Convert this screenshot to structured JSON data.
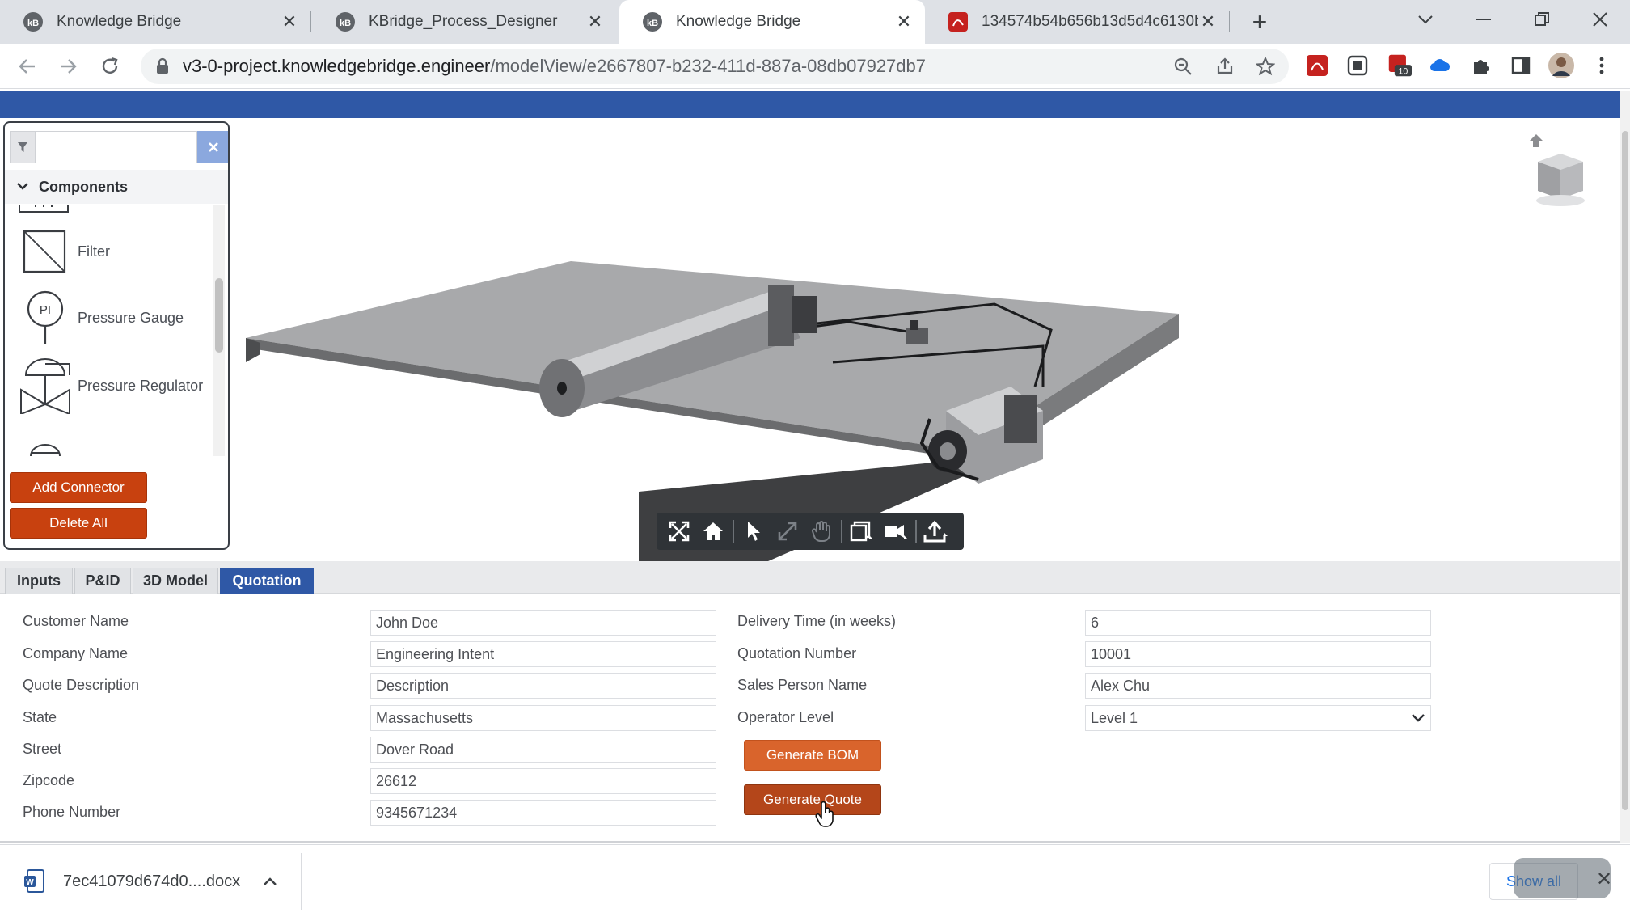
{
  "browser": {
    "tabs": [
      {
        "title": "Knowledge Bridge",
        "active": false
      },
      {
        "title": "KBridge_Process_Designer",
        "active": false
      },
      {
        "title": "Knowledge Bridge",
        "active": true
      },
      {
        "title": "134574b54b656b13d5d4c6130b",
        "active": false
      }
    ],
    "url_host": "v3-0-project.knowledgebridge.engineer",
    "url_path": "/modelView/e2667807-b232-411d-887a-08db07927db7",
    "extension_badge": "10",
    "colors": {
      "tabstrip": "#dee1e6",
      "accent_blue": "#2f58a6"
    }
  },
  "palette": {
    "filter_placeholder": "",
    "section_title": "Components",
    "items": [
      {
        "label": "Filter",
        "icon": "filter-symbol-icon"
      },
      {
        "label": "Pressure Gauge",
        "icon": "pressure-gauge-symbol-icon",
        "symbol_text": "PI"
      },
      {
        "label": "Pressure Regulator",
        "icon": "pressure-regulator-symbol-icon"
      }
    ],
    "add_connector_label": "Add Connector",
    "delete_all_label": "Delete All"
  },
  "viewer": {
    "toolbar_tools": [
      "fullscreen",
      "home",
      "select",
      "zoom-fit",
      "pan",
      "section",
      "camera",
      "export"
    ]
  },
  "lower_tabs": [
    {
      "label": "Inputs",
      "active": false
    },
    {
      "label": "P&ID",
      "active": false
    },
    {
      "label": "3D Model",
      "active": false
    },
    {
      "label": "Quotation",
      "active": true
    }
  ],
  "form": {
    "left": [
      {
        "label": "Customer Name",
        "value": "John Doe"
      },
      {
        "label": "Company Name",
        "value": "Engineering Intent"
      },
      {
        "label": "Quote Description",
        "value": "Description"
      },
      {
        "label": "State",
        "value": "Massachusetts"
      },
      {
        "label": "Street",
        "value": "Dover Road"
      },
      {
        "label": "Zipcode",
        "value": "26612"
      },
      {
        "label": "Phone Number",
        "value": "9345671234"
      }
    ],
    "right": [
      {
        "label": "Delivery Time (in weeks)",
        "value": "6"
      },
      {
        "label": "Quotation Number",
        "value": "10001"
      },
      {
        "label": "Sales Person Name",
        "value": "Alex Chu"
      },
      {
        "label": "Operator Level",
        "value": "Level 1"
      }
    ],
    "generate_bom_label": "Generate BOM",
    "generate_quote_label": "Generate Quote"
  },
  "download_bar": {
    "file_name": "7ec41079d674d0....docx",
    "show_all_label": "Show all"
  }
}
